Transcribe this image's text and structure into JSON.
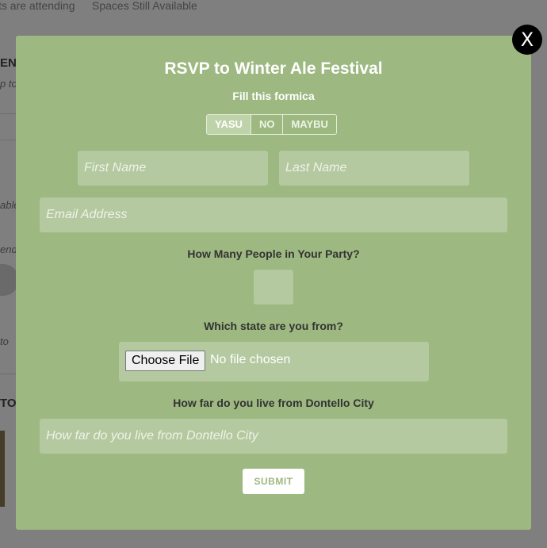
{
  "background": {
    "stats": [
      "ts are attending",
      "Spaces Still Available"
    ],
    "fragments": [
      "EN",
      "p to",
      "able",
      "end",
      "to",
      "TO"
    ]
  },
  "modal": {
    "close_label": "X",
    "title": "RSVP to Winter Ale Festival",
    "subtitle": "Fill this formica",
    "rsvp_options": [
      "YASU",
      "NO",
      "MAYBU"
    ],
    "rsvp_selected": "YASU",
    "first_name_placeholder": "First Name",
    "last_name_placeholder": "Last Name",
    "email_placeholder": "Email Address",
    "party_label": "How Many People in Your Party?",
    "party_value": "",
    "state_label": "Which state are you from?",
    "file_button_label": "Choose File",
    "file_status": "No file chosen",
    "distance_label": "How far do you live from Dontello City",
    "distance_placeholder": "How far do you live from Dontello City",
    "submit_label": "SUBMIT"
  },
  "colors": {
    "modal_bg": "#9db880",
    "field_bg": "#b4c9a0",
    "overlay": "rgba(0,0,0,0.5)"
  }
}
